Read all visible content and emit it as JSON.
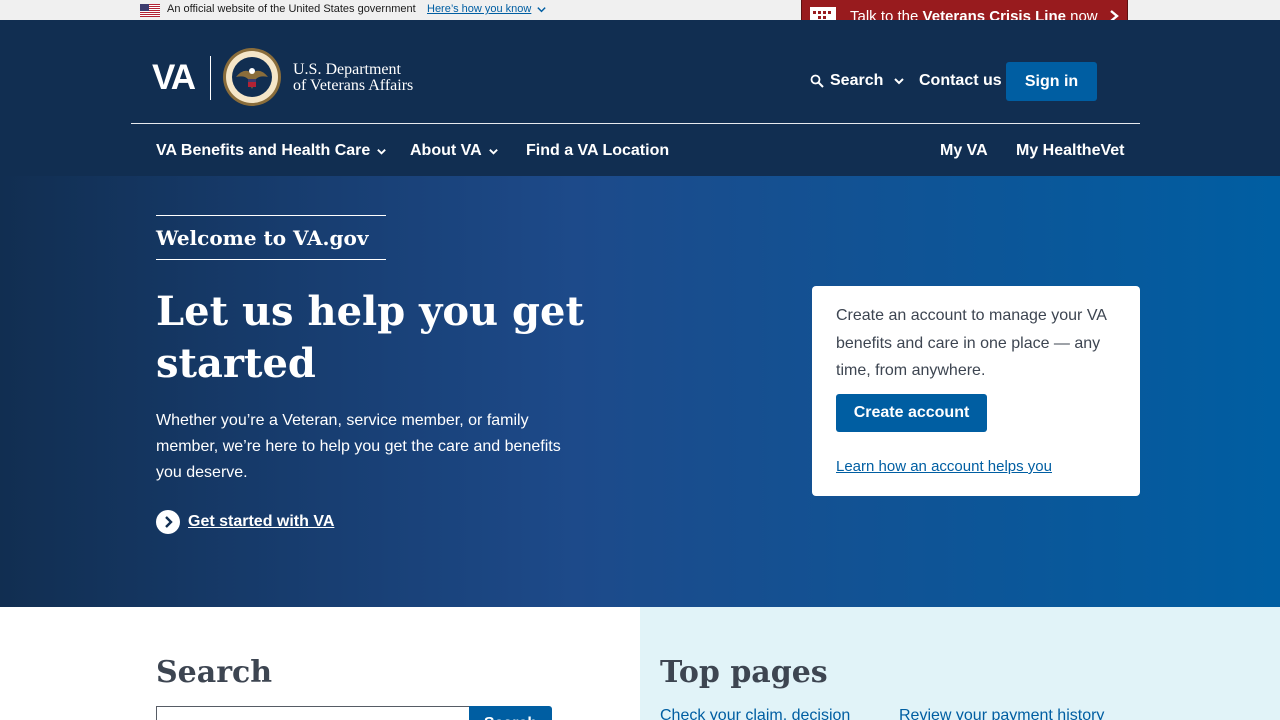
{
  "banner": {
    "official_text": "An official website of the United States government",
    "how_link": "Here’s how you know",
    "crisis_prefix": "Talk to the ",
    "crisis_bold": "Veterans Crisis Line",
    "crisis_suffix": " now"
  },
  "header": {
    "logo_text": "VA",
    "dept_line1": "U.S. Department",
    "dept_line2": "of Veterans Affairs",
    "search_label": "Search",
    "contact_label": "Contact us",
    "signin_label": "Sign in"
  },
  "nav": {
    "benefits": "VA Benefits and Health Care",
    "about": "About VA",
    "find": "Find a VA Location",
    "myva": "My VA",
    "healthevet": "My HealtheVet"
  },
  "hero": {
    "welcome": "Welcome to VA.gov",
    "title": "Let us help you get started",
    "body": "Whether you’re a Veteran, service member, or family member, we’re here to help you get the care and benefits you deserve.",
    "get_started": "Get started with VA"
  },
  "account_card": {
    "text": "Create an account to manage your VA benefits and care in one place — any time, from anywhere.",
    "button": "Create account",
    "link": "Learn how an account helps you"
  },
  "search_section": {
    "title": "Search",
    "input_value": "",
    "button": "Search"
  },
  "top_pages": {
    "title": "Top pages",
    "links": [
      "Check your claim, decision",
      "Review your payment history"
    ]
  },
  "colors": {
    "header_bg": "#112e51",
    "primary": "#005ea2",
    "crisis_red": "#981b1e",
    "top_pages_bg": "#e1f3f8"
  }
}
